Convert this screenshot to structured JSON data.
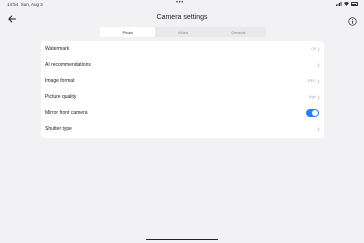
{
  "status": {
    "time": "14:54",
    "date": "Sun, Aug 3",
    "battery": "84"
  },
  "header": {
    "title": "Camera settings",
    "back_icon": "back-arrow-icon",
    "info_icon": "info-icon"
  },
  "tabs": [
    {
      "label": "Photo",
      "active": true
    },
    {
      "label": "Video",
      "active": false
    },
    {
      "label": "General",
      "active": false
    }
  ],
  "settings": [
    {
      "label": "Watermark",
      "value": "Off"
    },
    {
      "label": "AI recommendations",
      "value": ""
    },
    {
      "label": "Image format",
      "value": "JPEG"
    },
    {
      "label": "Picture quality",
      "value": "High"
    },
    {
      "label": "Mirror front camera",
      "toggle": true
    },
    {
      "label": "Shutter type",
      "value": ""
    }
  ],
  "colors": {
    "accent": "#2f7df5",
    "background": "#f2f2f4",
    "card": "#ffffff"
  }
}
